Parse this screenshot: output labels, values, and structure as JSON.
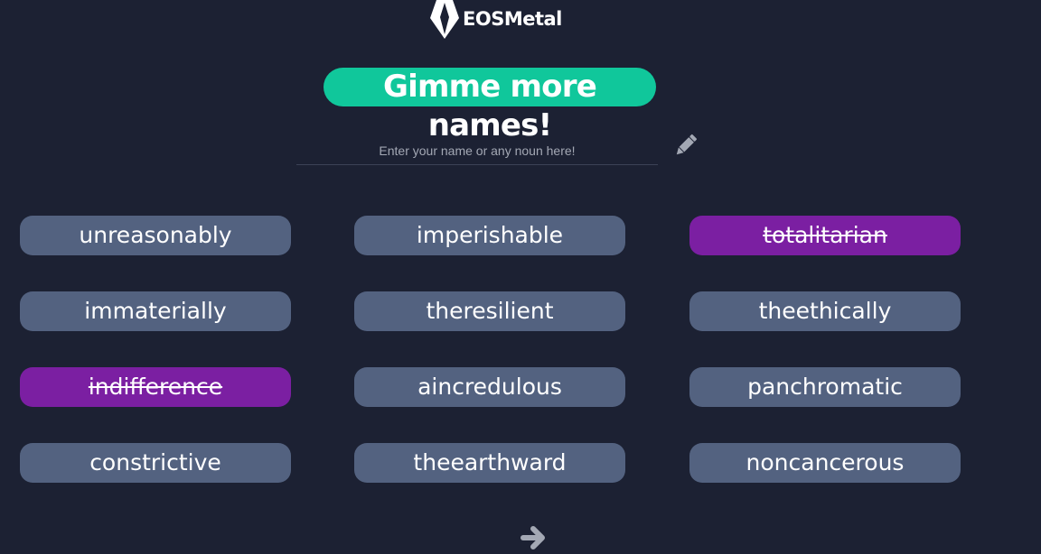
{
  "brand": {
    "name": "EOSMetal",
    "icon": "eosmetal-logo-icon"
  },
  "hero": {
    "cta_label": "Gimme more names!"
  },
  "search": {
    "placeholder": "Enter your name or any noun here!",
    "value": "",
    "edit_icon": "pencil-icon"
  },
  "names": [
    {
      "label": "unreasonably",
      "taken": false
    },
    {
      "label": "imperishable",
      "taken": false
    },
    {
      "label": "totalitarian",
      "taken": true
    },
    {
      "label": "immaterially",
      "taken": false
    },
    {
      "label": "theresilient",
      "taken": false
    },
    {
      "label": "theethically",
      "taken": false
    },
    {
      "label": "indifference",
      "taken": true
    },
    {
      "label": "aincredulous",
      "taken": false
    },
    {
      "label": "panchromatic",
      "taken": false
    },
    {
      "label": "constrictive",
      "taken": false
    },
    {
      "label": "theearthward",
      "taken": false
    },
    {
      "label": "noncancerous",
      "taken": false
    }
  ],
  "pagination": {
    "next_icon": "arrow-right-icon"
  },
  "colors": {
    "background": "#1c2133",
    "accent": "#10c79b",
    "pill_available": "#536280",
    "pill_taken": "#7b1fa2"
  }
}
